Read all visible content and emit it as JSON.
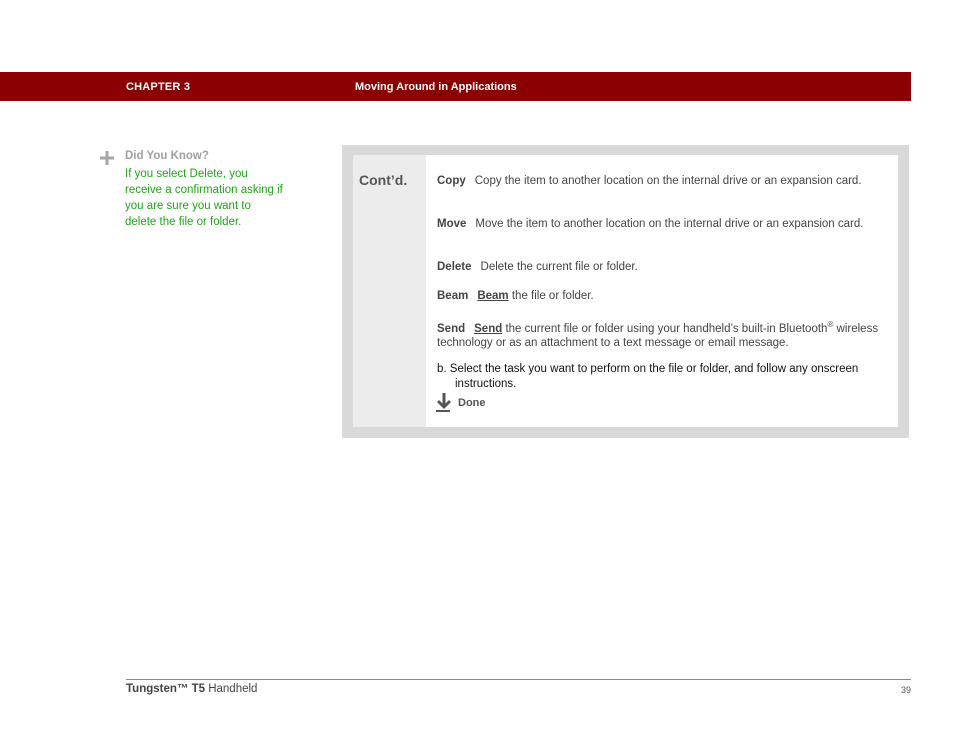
{
  "header": {
    "chapter": "CHAPTER 3",
    "title": "Moving Around in Applications",
    "bar_color": "#8b0000"
  },
  "tip": {
    "icon": "plus-icon",
    "heading": "Did You Know?",
    "body": "If you select Delete, you receive a confirmation asking if you are sure you want to delete the file or folder.",
    "color": "#22a31a"
  },
  "box": {
    "label": "Cont’d.",
    "items": [
      {
        "term": "Copy",
        "text": "Copy the item to another location on the internal drive or an expansion card."
      },
      {
        "term": "Move",
        "text": "Move the item to another location on the internal drive or an expansion card."
      },
      {
        "term": "Delete",
        "text": "Delete the current file or folder."
      },
      {
        "term": "Beam",
        "link": "Beam",
        "text": " the file or folder."
      },
      {
        "term": "Send",
        "link": "Send",
        "text": " the current file or folder using your handheld’s built-in Bluetooth",
        "sup": "®",
        "text2": " wireless technology or as an attachment to a text message or email message."
      }
    ],
    "step": "b.  Select the task you want to perform on the file or folder, and follow any onscreen instructions.",
    "done_icon": "arrow-down-icon",
    "done": "Done"
  },
  "footer": {
    "product_name": "Tungsten™ T5",
    "product_suffix": " Handheld",
    "page": "39"
  }
}
